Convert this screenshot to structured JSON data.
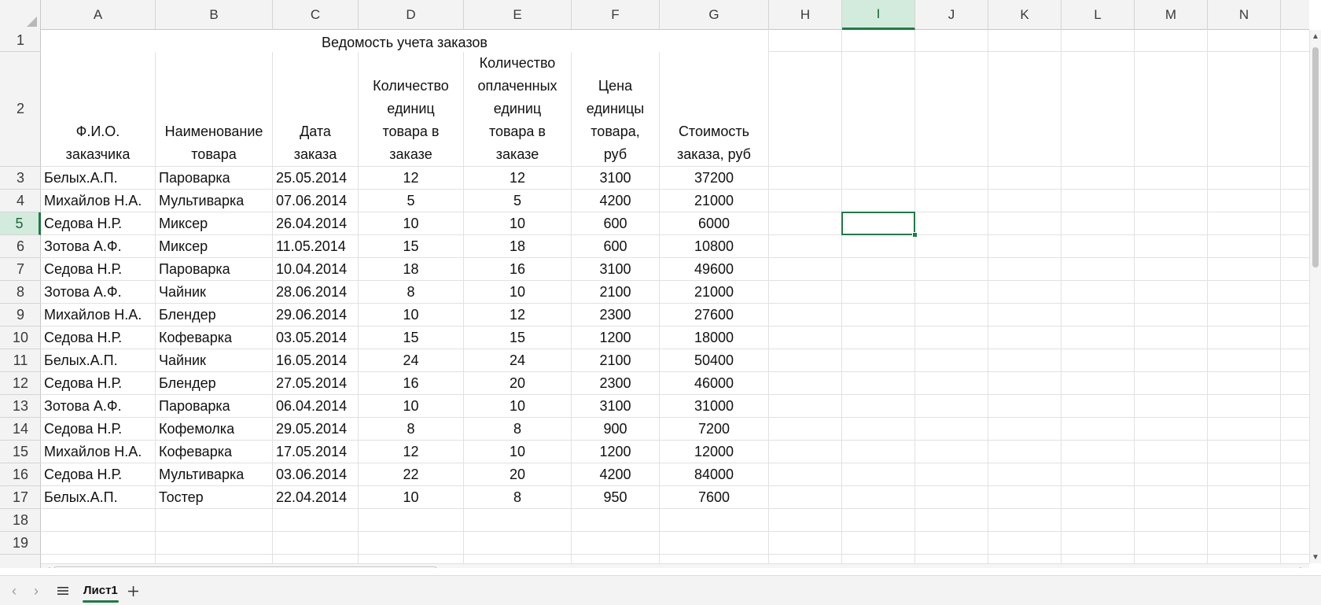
{
  "columns": [
    "A",
    "B",
    "C",
    "D",
    "E",
    "F",
    "G",
    "H",
    "I",
    "J",
    "K",
    "L",
    "M",
    "N"
  ],
  "rows": [
    "1",
    "2",
    "3",
    "4",
    "5",
    "6",
    "7",
    "8",
    "9",
    "10",
    "11",
    "12",
    "13",
    "14",
    "15",
    "16",
    "17",
    "18",
    "19"
  ],
  "selected_column": "I",
  "selected_row": "5",
  "title": "Ведомость учета заказов",
  "headers": [
    [
      "Ф.И.О.",
      "заказчика"
    ],
    [
      "Наименование",
      "товара"
    ],
    [
      "Дата",
      "заказа"
    ],
    [
      "Количество",
      "единиц",
      "товара в",
      "заказе"
    ],
    [
      "Количество",
      "оплаченных",
      "единиц",
      "товара в",
      "заказе"
    ],
    [
      "Цена",
      "единицы",
      "товара,",
      "руб"
    ],
    [
      "Стоимость",
      "заказа, руб"
    ]
  ],
  "table_rows": [
    [
      "Белых.А.П.",
      "Пароварка",
      "25.05.2014",
      "12",
      "12",
      "3100",
      "37200"
    ],
    [
      "Михайлов Н.А.",
      "Мультиварка",
      "07.06.2014",
      "5",
      "5",
      "4200",
      "21000"
    ],
    [
      "Седова Н.Р.",
      "Миксер",
      "26.04.2014",
      "10",
      "10",
      "600",
      "6000"
    ],
    [
      "Зотова А.Ф.",
      "Миксер",
      "11.05.2014",
      "15",
      "18",
      "600",
      "10800"
    ],
    [
      "Седова Н.Р.",
      "Пароварка",
      "10.04.2014",
      "18",
      "16",
      "3100",
      "49600"
    ],
    [
      "Зотова А.Ф.",
      "Чайник",
      "28.06.2014",
      "8",
      "10",
      "2100",
      "21000"
    ],
    [
      "Михайлов Н.А.",
      "Блендер",
      "29.06.2014",
      "10",
      "12",
      "2300",
      "27600"
    ],
    [
      "Седова Н.Р.",
      "Кофеварка",
      "03.05.2014",
      "15",
      "15",
      "1200",
      "18000"
    ],
    [
      "Белых.А.П.",
      "Чайник",
      "16.05.2014",
      "24",
      "24",
      "2100",
      "50400"
    ],
    [
      "Седова Н.Р.",
      "Блендер",
      "27.05.2014",
      "16",
      "20",
      "2300",
      "46000"
    ],
    [
      "Зотова А.Ф.",
      "Пароварка",
      "06.04.2014",
      "10",
      "10",
      "3100",
      "31000"
    ],
    [
      "Седова Н.Р.",
      "Кофемолка",
      "29.05.2014",
      "8",
      "8",
      "900",
      "7200"
    ],
    [
      "Михайлов Н.А.",
      "Кофеварка",
      "17.05.2014",
      "12",
      "10",
      "1200",
      "12000"
    ],
    [
      "Седова Н.Р.",
      "Мультиварка",
      "03.06.2014",
      "22",
      "20",
      "4200",
      "84000"
    ],
    [
      "Белых.А.П.",
      "Тостер",
      "22.04.2014",
      "10",
      "8",
      "950",
      "7600"
    ]
  ],
  "sheet_tab": "Лист1",
  "icons": {
    "prev_sheet": "chevron-left-icon",
    "next_sheet": "chevron-right-icon",
    "sheet_list": "hamburger-menu-icon",
    "add_sheet": "plus-icon"
  },
  "colors": {
    "accent": "#1f7a45",
    "selection_fill": "#d3ebdc"
  }
}
